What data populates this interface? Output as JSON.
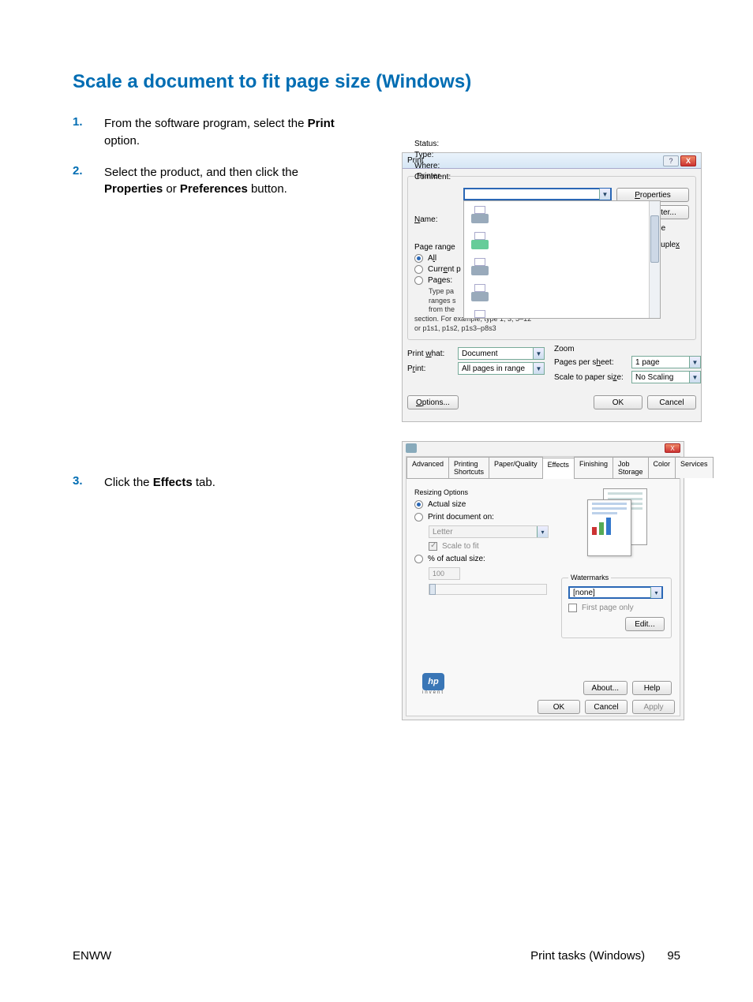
{
  "heading": "Scale a document to fit page size (Windows)",
  "steps": [
    {
      "num": "1.",
      "pre": "From the software program, select the ",
      "bold1": "Print",
      "mid": " option.",
      "bold2": "",
      "post": ""
    },
    {
      "num": "2.",
      "pre": "Select the product, and then click the ",
      "bold1": "Properties",
      "mid": " or ",
      "bold2": "Preferences",
      "post": " button."
    },
    {
      "num": "3.",
      "pre": "Click the ",
      "bold1": "Effects",
      "mid": " tab.",
      "bold2": "",
      "post": ""
    }
  ],
  "footer": {
    "left": "ENWW",
    "right_label": "Print tasks (Windows)",
    "page": "95"
  },
  "printDialog": {
    "title": "Print",
    "help": "?",
    "close": "X",
    "printerGroup": "Printer",
    "nameLabel": "Name:",
    "statusLabel": "Status:",
    "typeLabel": "Type:",
    "whereLabel": "Where:",
    "commentLabel": "Comment:",
    "propertiesBtn": "Properties",
    "findPrinterBtn": "Find Printer...",
    "printToFile": "Print to file",
    "manualDuplex": "Manual duplex",
    "pageRangeGroup": "Page range",
    "all": "All",
    "current": "Current p",
    "pages": "Pages:",
    "typeHint1": "Type pa",
    "typeHint2": "ranges s",
    "typeHint3": "from the",
    "typeHint4": "section. For example, type 1, 3, 5–12",
    "typeHint5": "or p1s1, p1s2, p1s3–p8s3",
    "printWhatLabel": "Print what:",
    "printWhatValue": "Document",
    "printLabel": "Print:",
    "printValue": "All pages in range",
    "zoomGroup": "Zoom",
    "pagesPerSheet": "Pages per sheet:",
    "pagesPerSheetValue": "1 page",
    "scaleToPaper": "Scale to paper size:",
    "scaleToPaperValue": "No Scaling",
    "optionsBtn": "Options...",
    "okBtn": "OK",
    "cancelBtn": "Cancel"
  },
  "propsDialog": {
    "close": "X",
    "tabs": [
      "Advanced",
      "Printing Shortcuts",
      "Paper/Quality",
      "Effects",
      "Finishing",
      "Job Storage",
      "Color",
      "Services"
    ],
    "activeTab": "Effects",
    "resizingGroup": "Resizing Options",
    "actualSize": "Actual size",
    "printDocOn": "Print document on:",
    "printDocOnValue": "Letter",
    "scaleToFit": "Scale to fit",
    "pctActual": "% of actual size:",
    "pctValue": "100",
    "watermarksGroup": "Watermarks",
    "watermarkValue": "[none]",
    "firstPageOnly": "First page only",
    "editBtn": "Edit...",
    "aboutBtn": "About...",
    "helpBtn": "Help",
    "okBtn": "OK",
    "cancelBtn": "Cancel",
    "applyBtn": "Apply",
    "hp": "hp",
    "invent": "invent"
  }
}
